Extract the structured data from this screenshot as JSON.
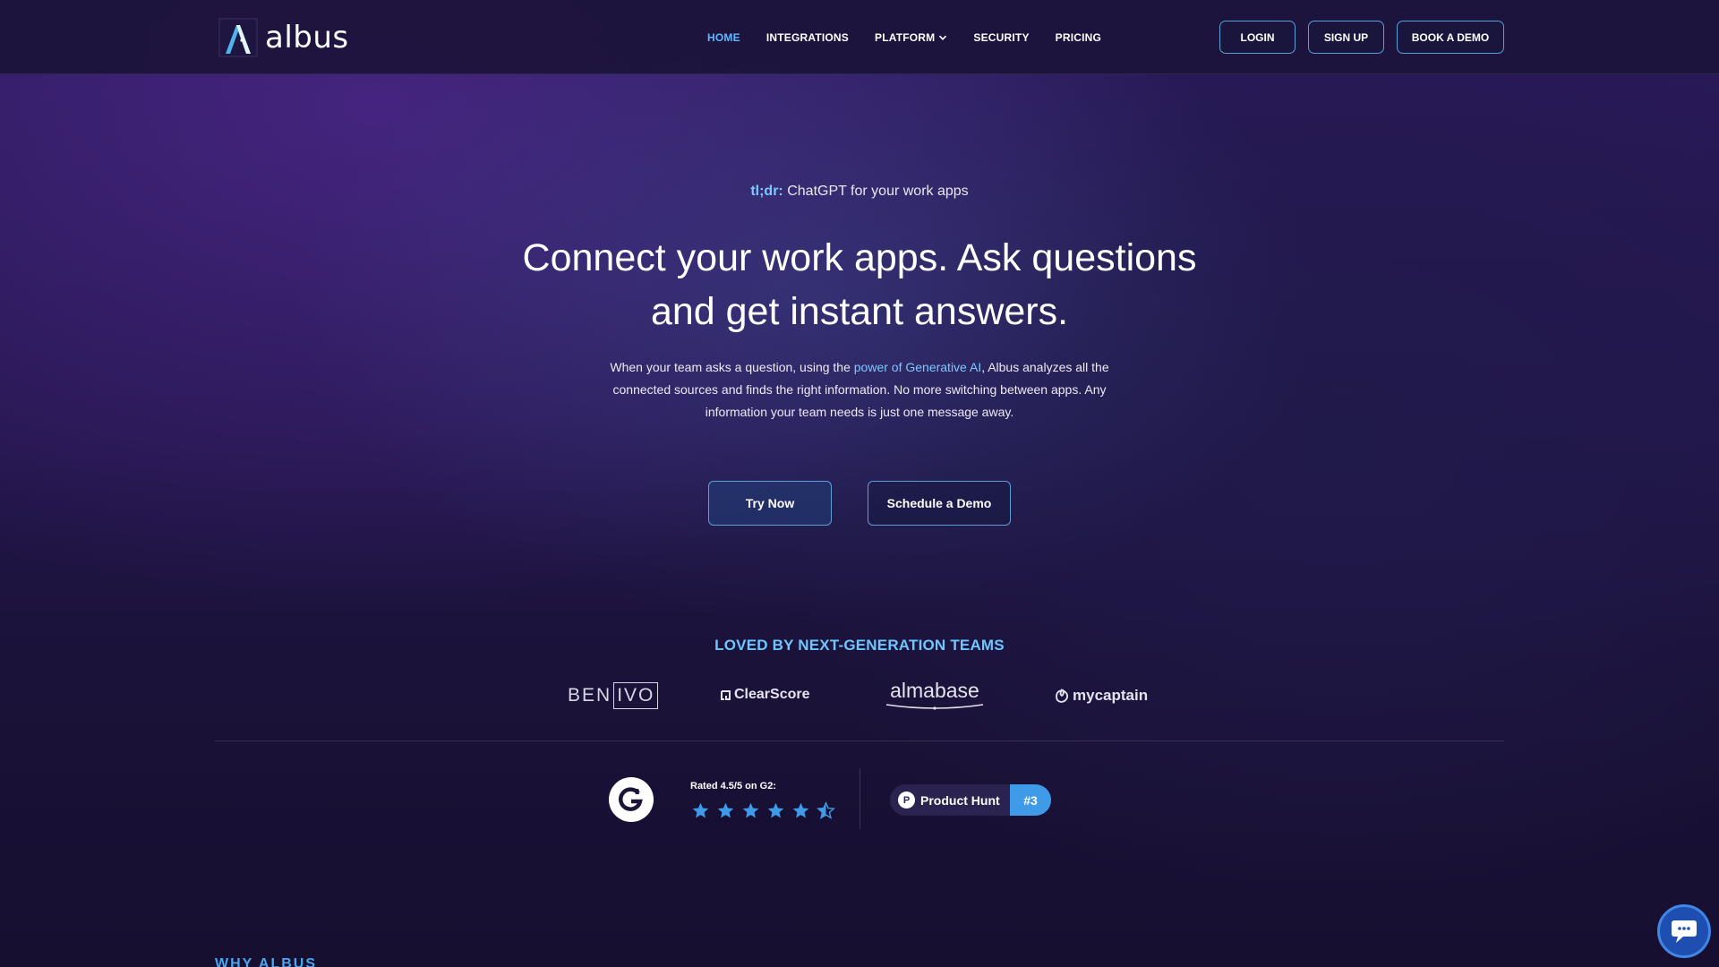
{
  "header": {
    "brand": "albus",
    "nav": [
      {
        "label": "HOME",
        "active": true
      },
      {
        "label": "INTEGRATIONS"
      },
      {
        "label": "PLATFORM",
        "dropdown": true
      },
      {
        "label": "SECURITY"
      },
      {
        "label": "PRICING"
      }
    ],
    "login": "LOGIN",
    "signup": "SIGN UP",
    "book_demo": "BOOK A DEMO"
  },
  "hero": {
    "tagline_prefix": "tl;dr:",
    "tagline": " ChatGPT for your work apps",
    "headline": "Connect your work apps. Ask questions and get instant answers.",
    "desc_before": "When your team asks a question, using the ",
    "desc_link": "power of Generative AI",
    "desc_after": ", Albus analyzes all the connected sources and finds the right information. No more switching between apps. Any information your team needs is just one message away.",
    "try_now": "Try Now",
    "schedule_demo": "Schedule a Demo"
  },
  "customers": {
    "heading": "LOVED BY NEXT-GENERATION TEAMS",
    "logos": {
      "benivo_a": "BEN",
      "benivo_b": "IVO",
      "clearscore": "ClearScore",
      "almabase": "almabase",
      "mycaptain": "mycaptain"
    }
  },
  "ratings": {
    "g2_label": "Rated 4.5/5 on G2:",
    "g2_rating": 4.5,
    "g2_max": 5,
    "producthunt_label": "Product Hunt",
    "producthunt_rank": "#3"
  },
  "next_section": "WHY ALBUS",
  "colors": {
    "accent": "#5fb7ff",
    "button_border": "#5b9fd6",
    "star": "#3f9be8"
  },
  "icons": [
    "albus-logo-icon",
    "chevron-down-icon",
    "g2-logo-icon",
    "star-icon",
    "product-hunt-icon",
    "chat-icon"
  ]
}
